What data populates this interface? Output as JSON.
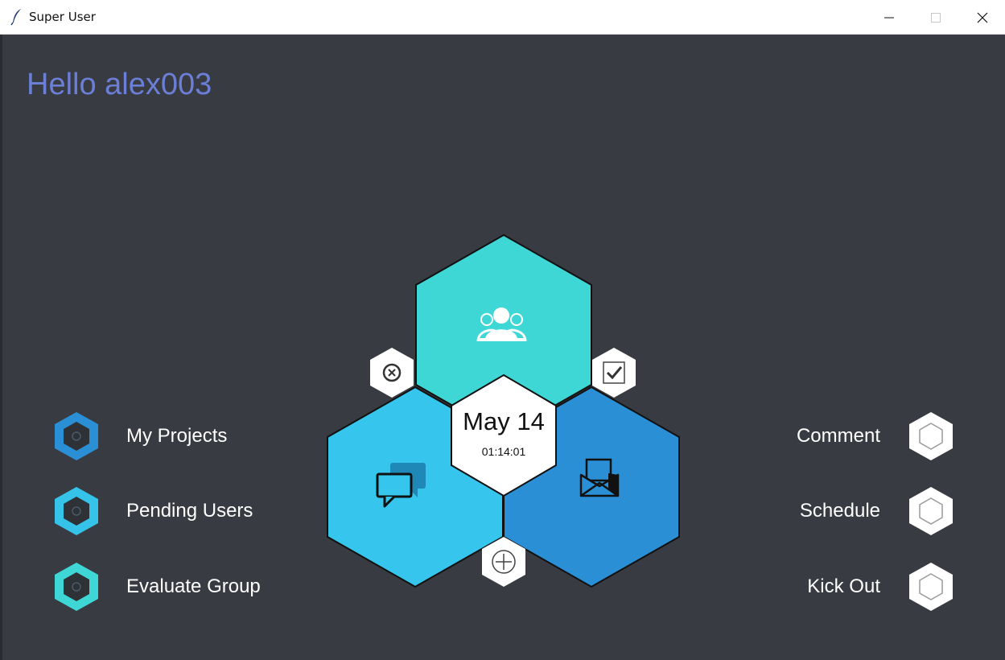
{
  "window": {
    "title": "Super User"
  },
  "greeting": "Hello alex003",
  "left_menu": [
    {
      "label": "My Projects",
      "color": "#2b8fd6"
    },
    {
      "label": "Pending Users",
      "color": "#35c3ea"
    },
    {
      "label": "Evaluate Group",
      "color": "#3ed7d5"
    }
  ],
  "right_menu": [
    {
      "label": "Comment"
    },
    {
      "label": "Schedule"
    },
    {
      "label": "Kick Out"
    }
  ],
  "center": {
    "date": "May 14",
    "time": "01:14:01",
    "icons": {
      "top": "group-icon",
      "left": "chat-icon",
      "right": "mail-icon"
    },
    "colors": {
      "top": "#3ed7d5",
      "left": "#35c5ed",
      "right": "#2b8fd6"
    }
  },
  "colors": {
    "background": "#393b42",
    "greeting": "#6b7fd7"
  }
}
